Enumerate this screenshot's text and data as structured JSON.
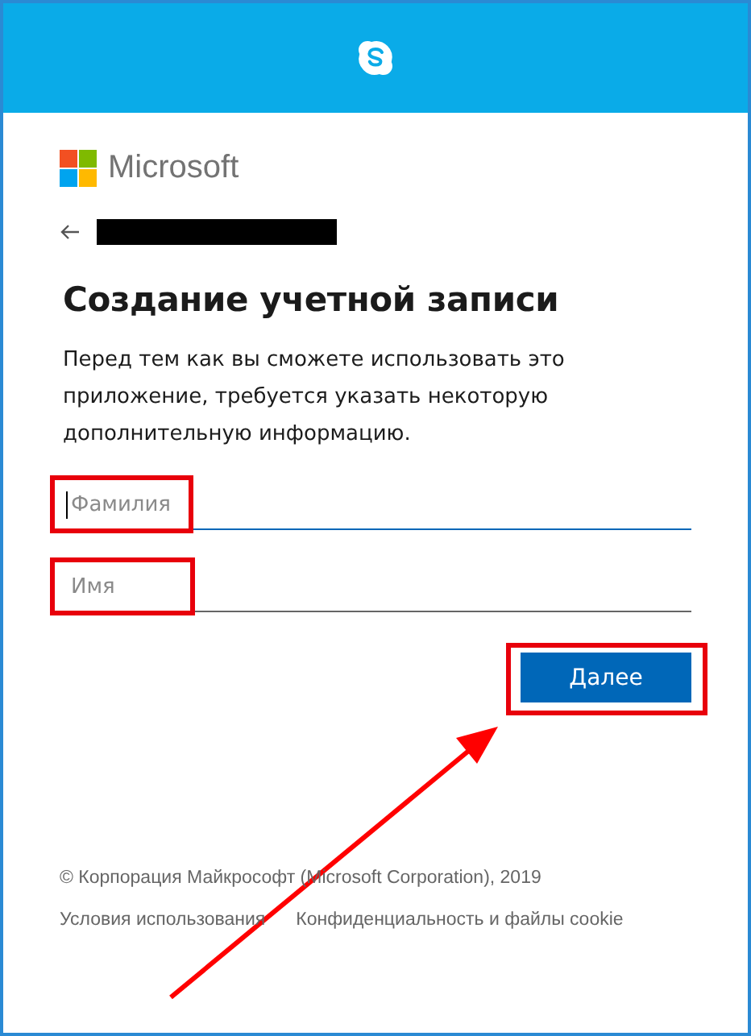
{
  "brand": {
    "name": "Microsoft"
  },
  "account": {
    "redacted": true
  },
  "title": "Создание учетной записи",
  "description": "Перед тем как вы сможете использовать это приложение, требуется указать некоторую дополнительную информацию.",
  "fields": [
    {
      "placeholder": "Фамилия",
      "focused": true,
      "highlighted": true
    },
    {
      "placeholder": "Имя",
      "focused": false,
      "highlighted": true
    }
  ],
  "next_button": {
    "label": "Далее",
    "highlighted": true
  },
  "annotation_arrow": true,
  "footer": {
    "copyright": "© Корпорация Майкрософт (Microsoft Corporation), 2019",
    "links": [
      "Условия использования",
      "Конфиденциальность и файлы cookie"
    ]
  }
}
